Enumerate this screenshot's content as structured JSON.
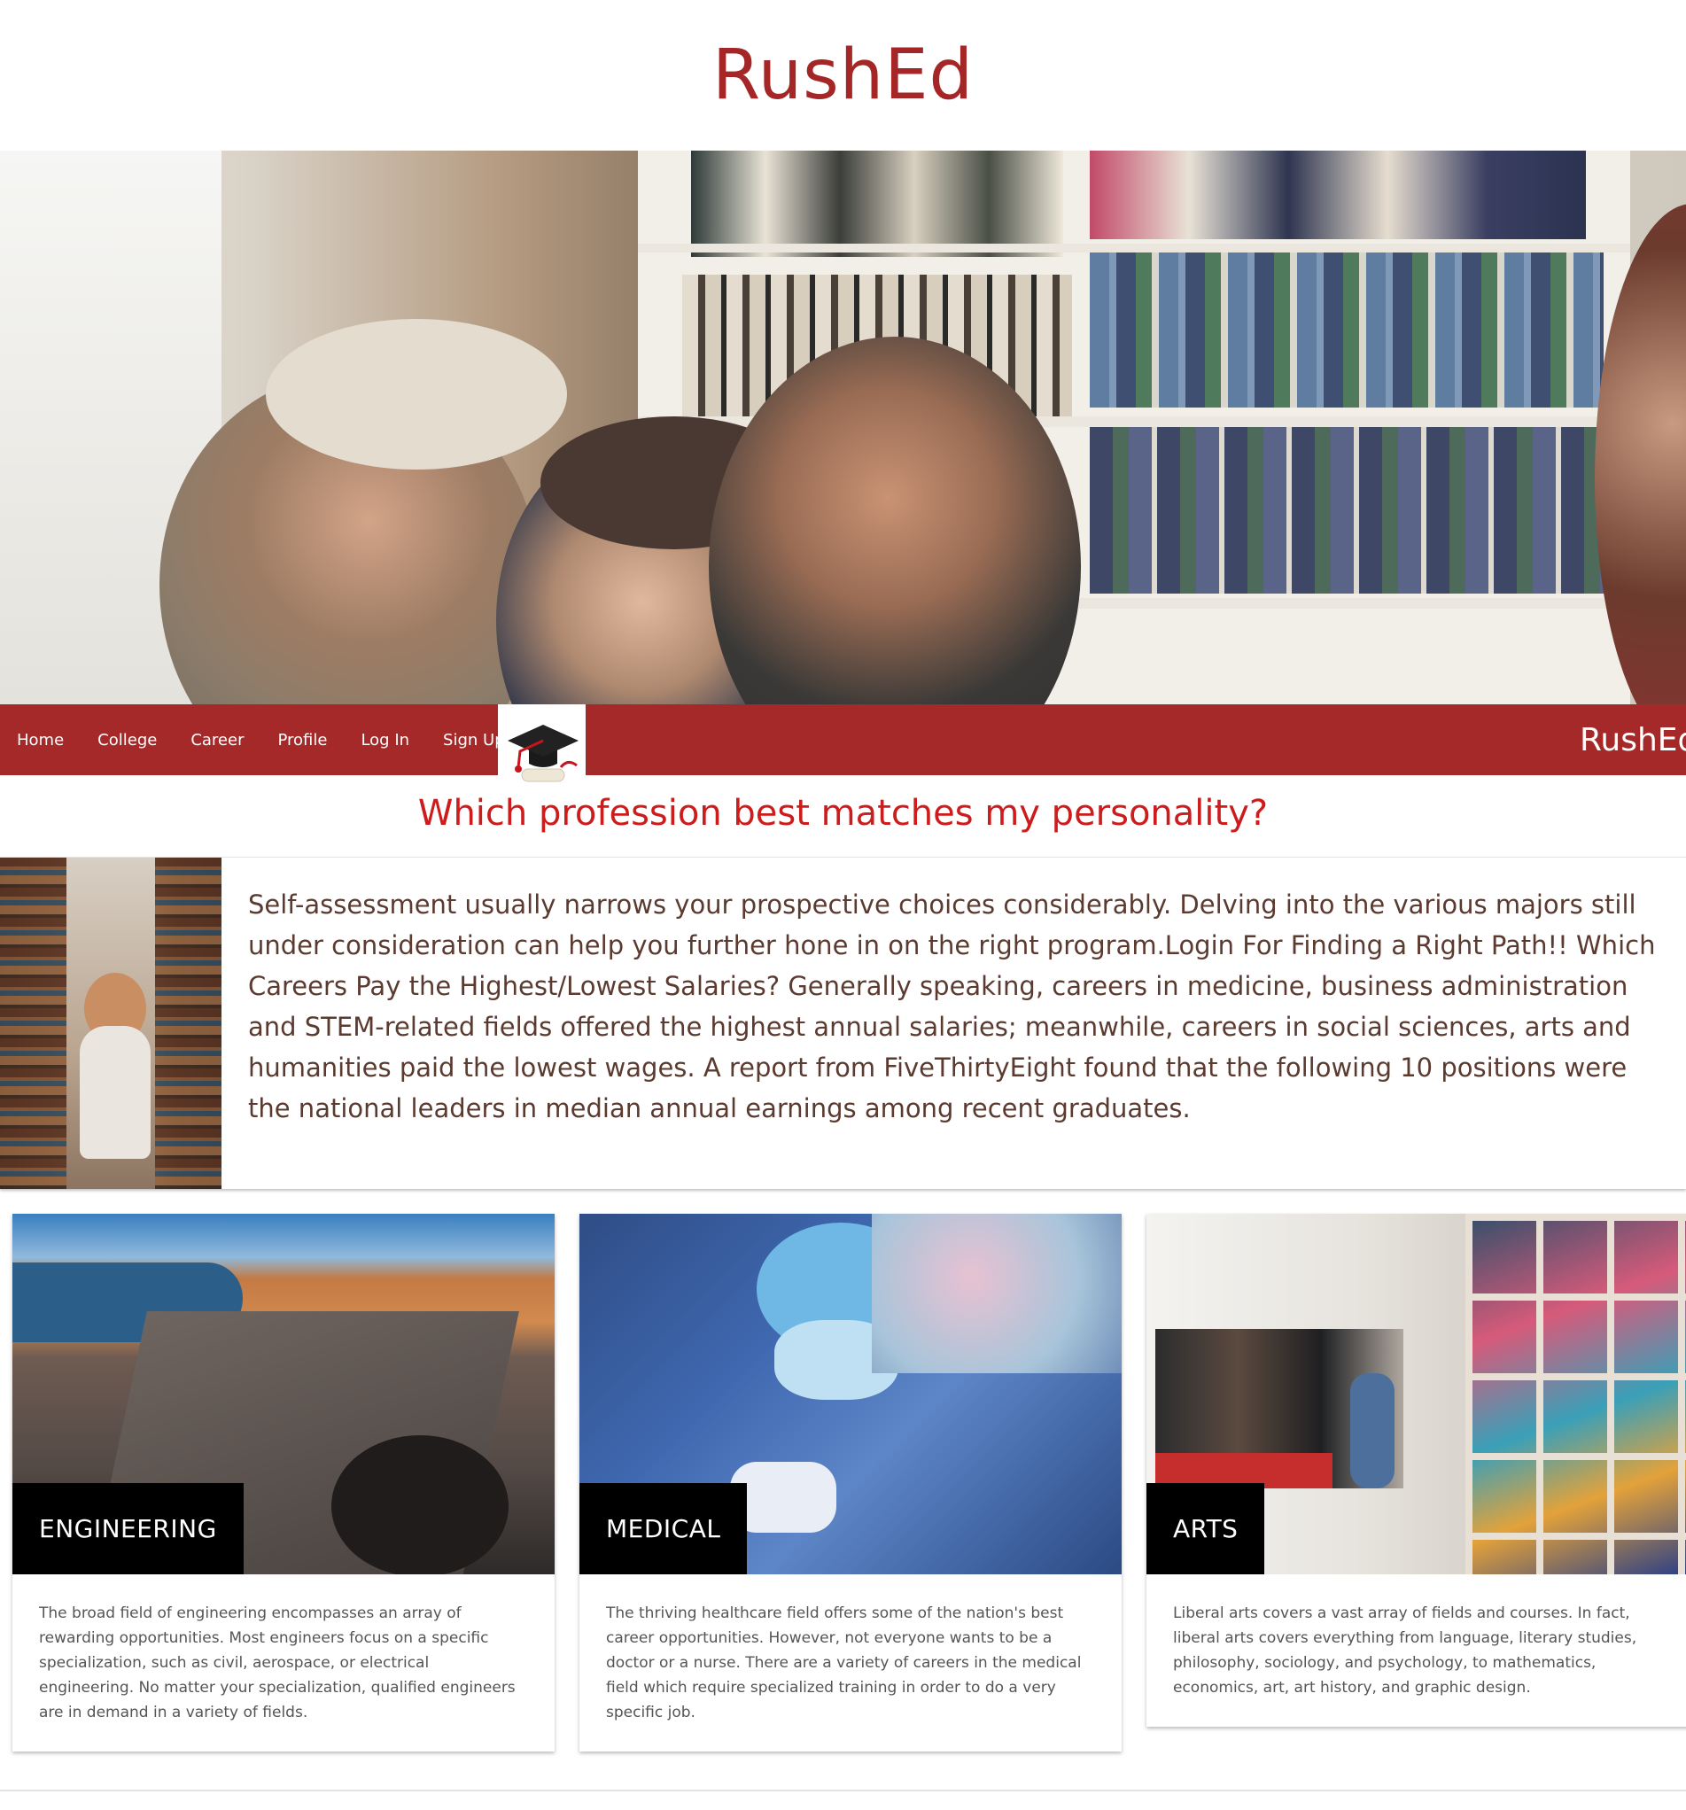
{
  "header": {
    "title": "RushEd"
  },
  "nav": {
    "items": [
      {
        "label": "Home"
      },
      {
        "label": "College"
      },
      {
        "label": "Career"
      },
      {
        "label": "Profile"
      },
      {
        "label": "Log In"
      },
      {
        "label": "Sign Up"
      }
    ],
    "logo_icon": "graduation-cap-icon",
    "brand": "RushEd"
  },
  "main": {
    "question": "Which profession best matches my personality?",
    "intro_text": "Self-assessment usually narrows your prospective choices considerably. Delving into the various majors still under consideration can help you further hone in on the right program.Login For Finding a Right Path!! Which Careers Pay the Highest/Lowest Salaries? Generally speaking, careers in medicine, business administration and STEM-related fields offered the highest annual salaries; meanwhile, careers in social sciences, arts and humanities paid the lowest wages. A report from FiveThirtyEight found that the following 10 positions were the national leaders in median annual earnings among recent graduates."
  },
  "cards": [
    {
      "label": "ENGINEERING",
      "text": "The broad field of engineering encompasses an array of rewarding opportunities. Most engineers focus on a specific specialization, such as civil, aerospace, or electrical engineering. No matter your specialization, qualified engineers are in demand in a variety of fields."
    },
    {
      "label": "MEDICAL",
      "text": "The thriving healthcare field offers some of the nation's best career opportunities. However, not everyone wants to be a doctor or a nurse. There are a variety of careers in the medical field which require specialized training in order to do a very specific job."
    },
    {
      "label": "ARTS",
      "text": "Liberal arts covers a vast array of fields and courses. In fact, liberal arts covers everything from language, literary studies, philosophy, sociology, and psychology, to mathematics, economics, art, art history, and graphic design."
    }
  ],
  "colors": {
    "brand": "#a52929",
    "question": "#cc1c1c",
    "body_text": "#5b3a30"
  }
}
